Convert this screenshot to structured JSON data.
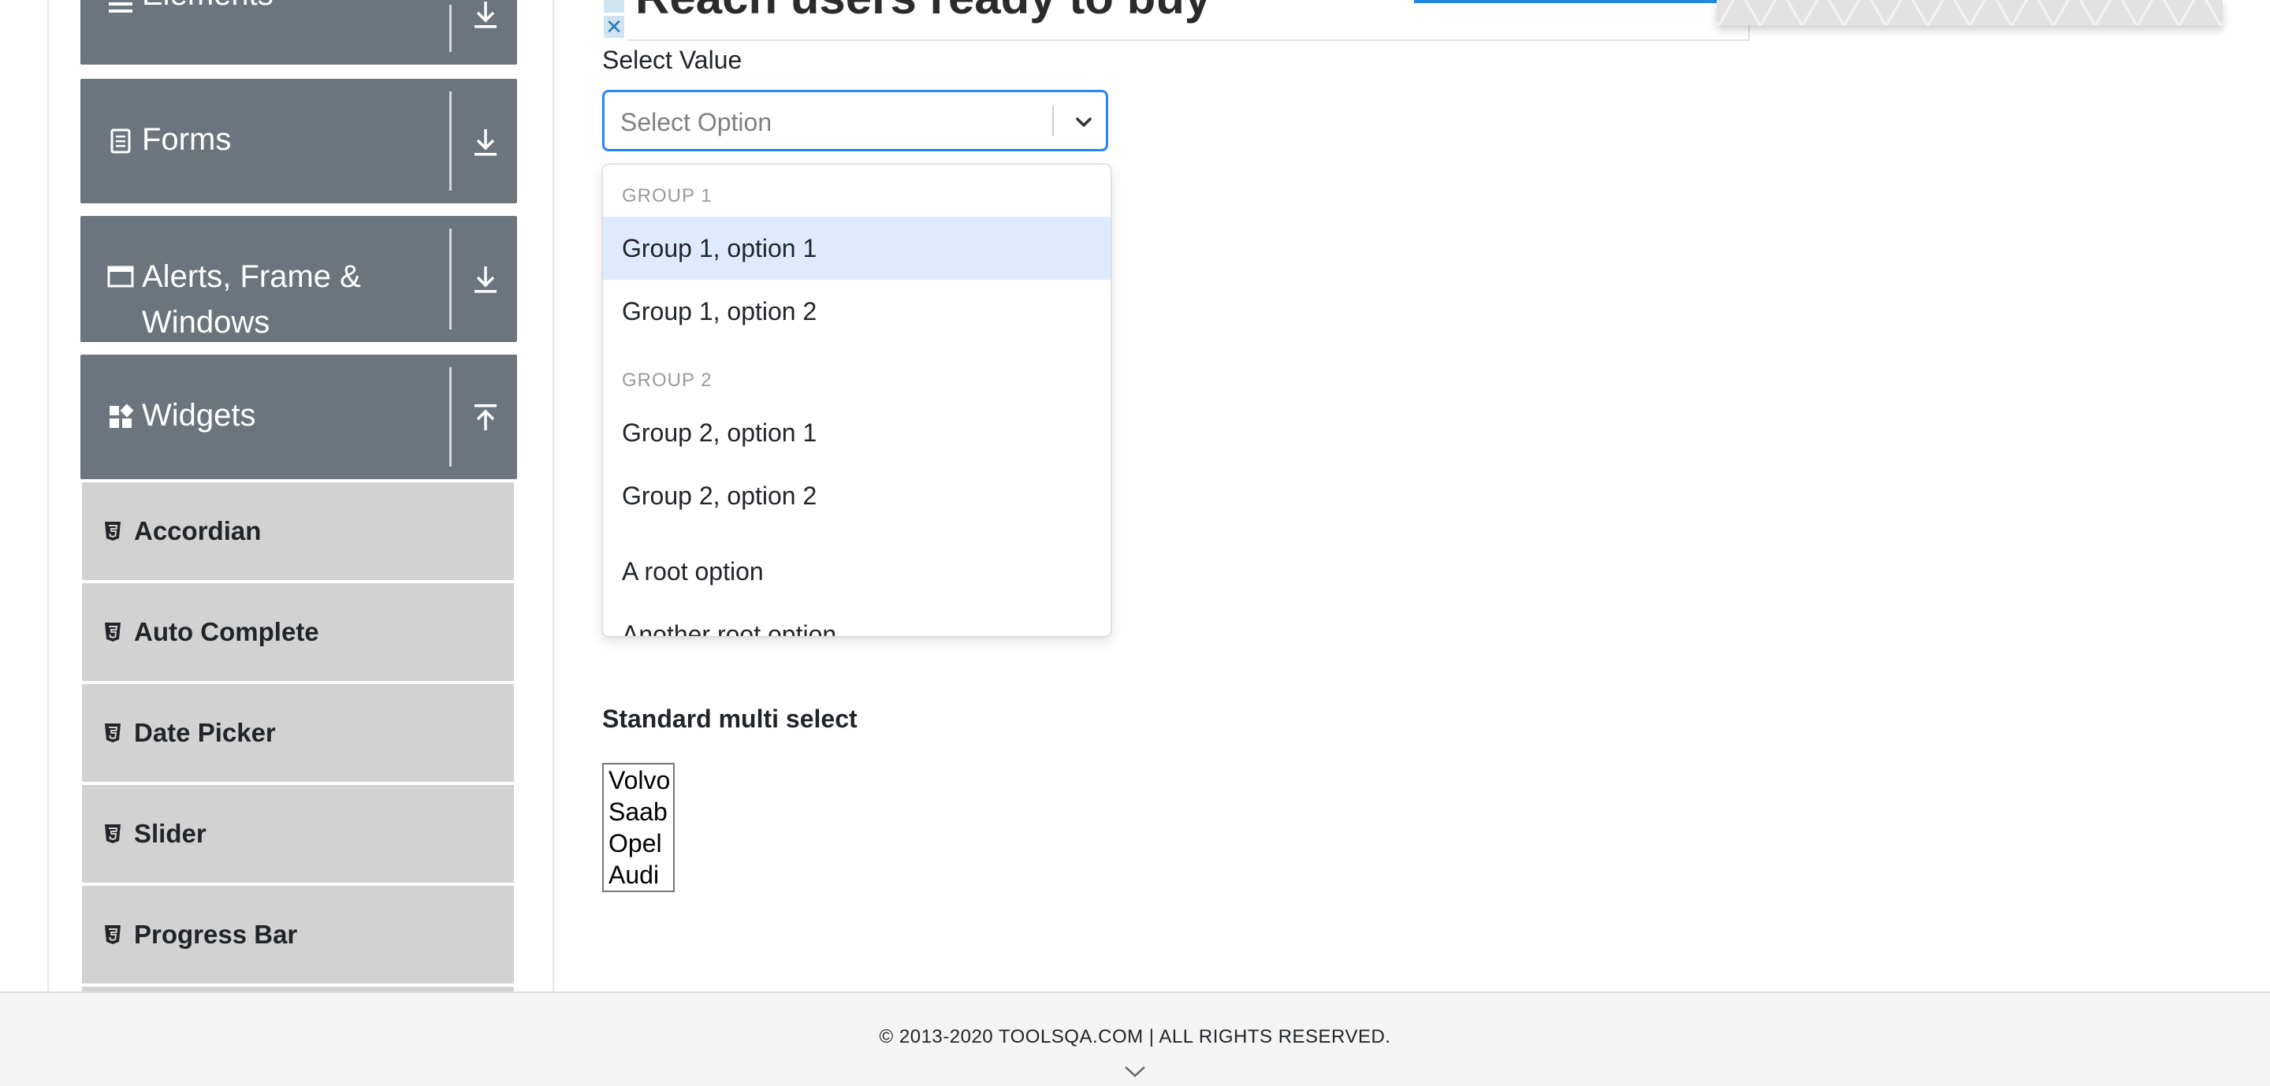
{
  "ad": {
    "headline": "Reach users ready to buy",
    "close_glyph": "✕"
  },
  "sidebar": {
    "groups": [
      {
        "label": "Elements",
        "icon": "list-icon",
        "arrow": "download-arrow-icon"
      },
      {
        "label": "Forms",
        "icon": "document-icon",
        "arrow": "download-arrow-icon"
      },
      {
        "label": "Alerts, Frame &",
        "label_line2": "Windows",
        "icon": "window-icon",
        "arrow": "download-arrow-icon"
      },
      {
        "label": "Widgets",
        "icon": "widgets-icon",
        "arrow": "upload-arrow-icon"
      }
    ],
    "items": [
      {
        "label": "Accordian",
        "icon": "html5-icon"
      },
      {
        "label": "Auto Complete",
        "icon": "html5-icon"
      },
      {
        "label": "Date Picker",
        "icon": "html5-icon"
      },
      {
        "label": "Slider",
        "icon": "html5-icon"
      },
      {
        "label": "Progress Bar",
        "icon": "html5-icon"
      }
    ]
  },
  "select_value": {
    "label": "Select Value",
    "placeholder": "Select Option",
    "menu": {
      "group1_heading": "GROUP 1",
      "group1_options": [
        "Group 1, option 1",
        "Group 1, option 2"
      ],
      "group2_heading": "GROUP 2",
      "group2_options": [
        "Group 2, option 1",
        "Group 2, option 2"
      ],
      "root_options": [
        "A root option",
        "Another root option"
      ],
      "focused_option": "Group 1, option 1"
    }
  },
  "multi_select": {
    "title": "Standard multi select",
    "options": [
      "Volvo",
      "Saab",
      "Opel",
      "Audi"
    ]
  },
  "footer": {
    "copyright": "© 2013-2020 TOOLSQA.COM | ALL RIGHTS RESERVED."
  },
  "colors": {
    "sidebar_group_bg": "#6c757d",
    "sidebar_item_bg": "#d2d2d2",
    "focus_blue": "#2684ff",
    "option_focus_bg": "#deebff",
    "footer_bg": "#f4f4f4"
  }
}
